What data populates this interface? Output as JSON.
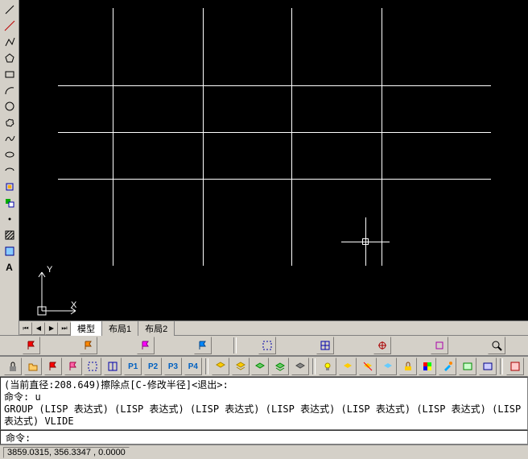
{
  "left_toolbar": [
    "line-icon",
    "polyline-icon",
    "polygon-icon",
    "rectangle-icon",
    "arc-icon",
    "circle-icon",
    "revcloud-icon",
    "spline-icon",
    "ellipse-icon",
    "ellipsearc-icon",
    "block-icon",
    "point-icon",
    "hatch-icon",
    "gradient-icon",
    "region-icon",
    "table-icon",
    "text-icon"
  ],
  "tabs": {
    "model": "模型",
    "layout1": "布局1",
    "layout2": "布局2"
  },
  "toolbar1": {
    "hint_p": [
      "P1",
      "P2",
      "P3",
      "P4"
    ]
  },
  "command_history": "(当前直径:208.649)擦除点[C-修改半径]<退出>:\n命令: u\nGROUP (LISP 表达式) (LISP 表达式) (LISP 表达式) (LISP 表达式) (LISP 表达式) (LISP 表达式) (LISP 表达式) VLIDE",
  "command_prompt": "命令:",
  "status": {
    "coords": "3859.0315, 356.3347 , 0.0000"
  },
  "ucs": {
    "x": "X",
    "y": "Y"
  }
}
